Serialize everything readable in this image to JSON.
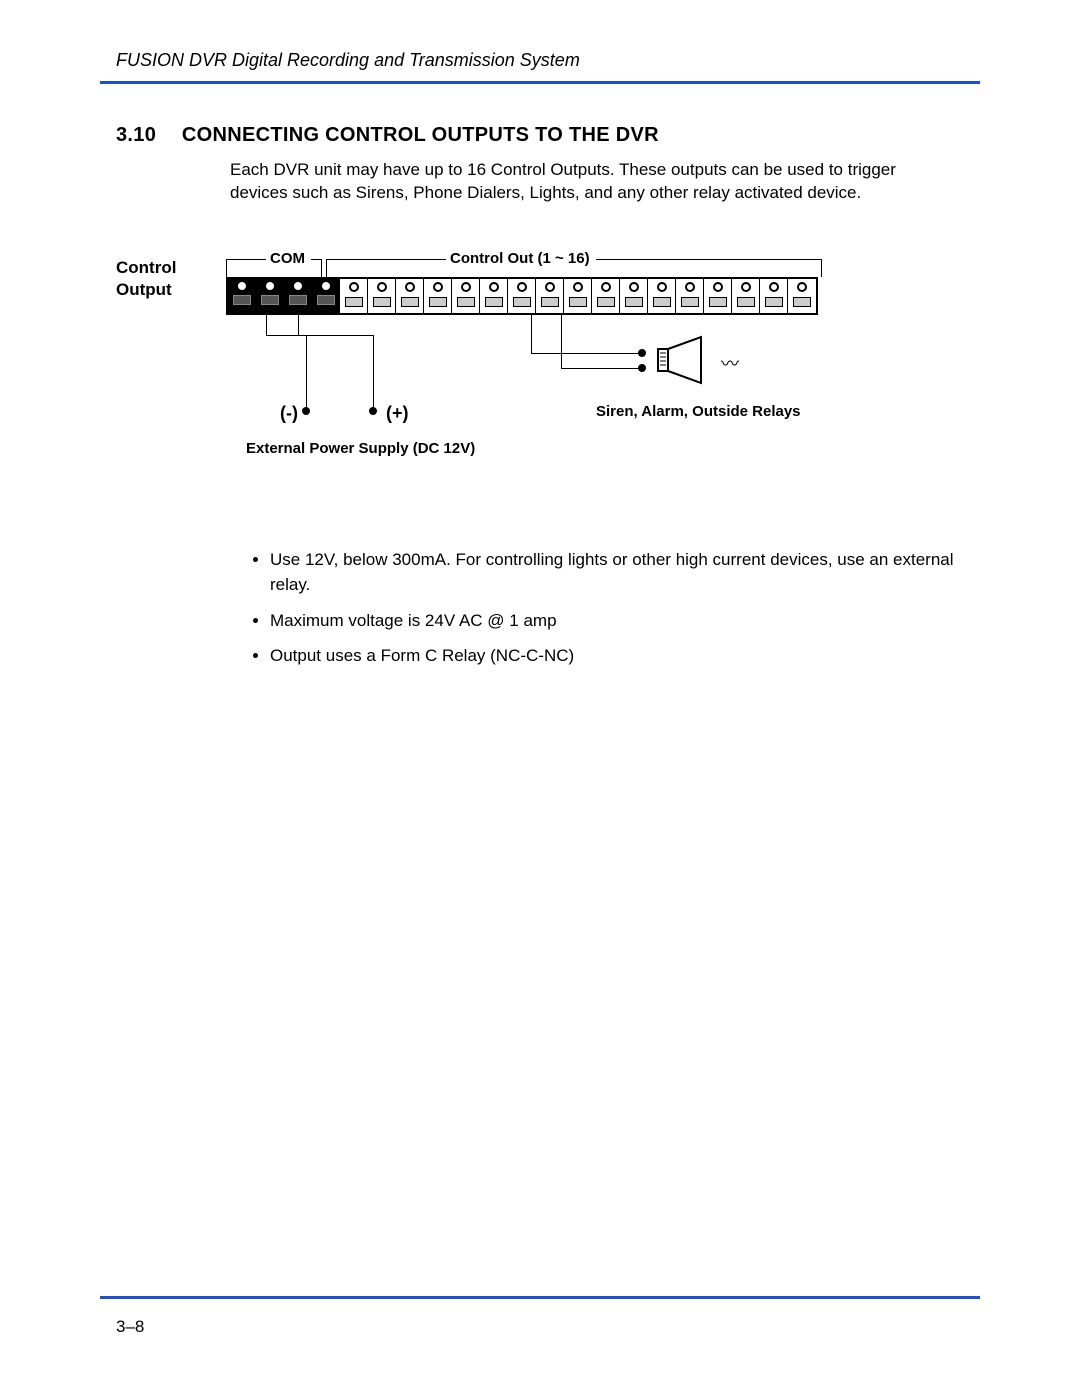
{
  "header": {
    "title": "FUSION DVR Digital Recording and Transmission System"
  },
  "section": {
    "number": "3.10",
    "title": "CONNECTING CONTROL OUTPUTS TO THE DVR",
    "intro": "Each DVR unit may have up to 16 Control Outputs. These outputs can be used to trigger devices such as Sirens, Phone Dialers, Lights, and any other relay activated device."
  },
  "diagram": {
    "side_label_1": "Control",
    "side_label_2": "Output",
    "com_label": "COM",
    "control_out_label": "Control Out (1 ~ 16)",
    "minus": "(-)",
    "plus": "(+)",
    "external_power": "External Power Supply (DC 12V)",
    "siren_label": "Siren, Alarm, Outside Relays",
    "terminals": {
      "com_count": 4,
      "output_count": 17
    }
  },
  "bullets": [
    "Use 12V, below 300mA. For controlling lights or other high current devices, use an external relay.",
    "Maximum voltage is 24V AC @ 1 amp",
    "Output uses a Form C Relay  (NC-C-NC)"
  ],
  "footer": {
    "page": "3–8"
  }
}
